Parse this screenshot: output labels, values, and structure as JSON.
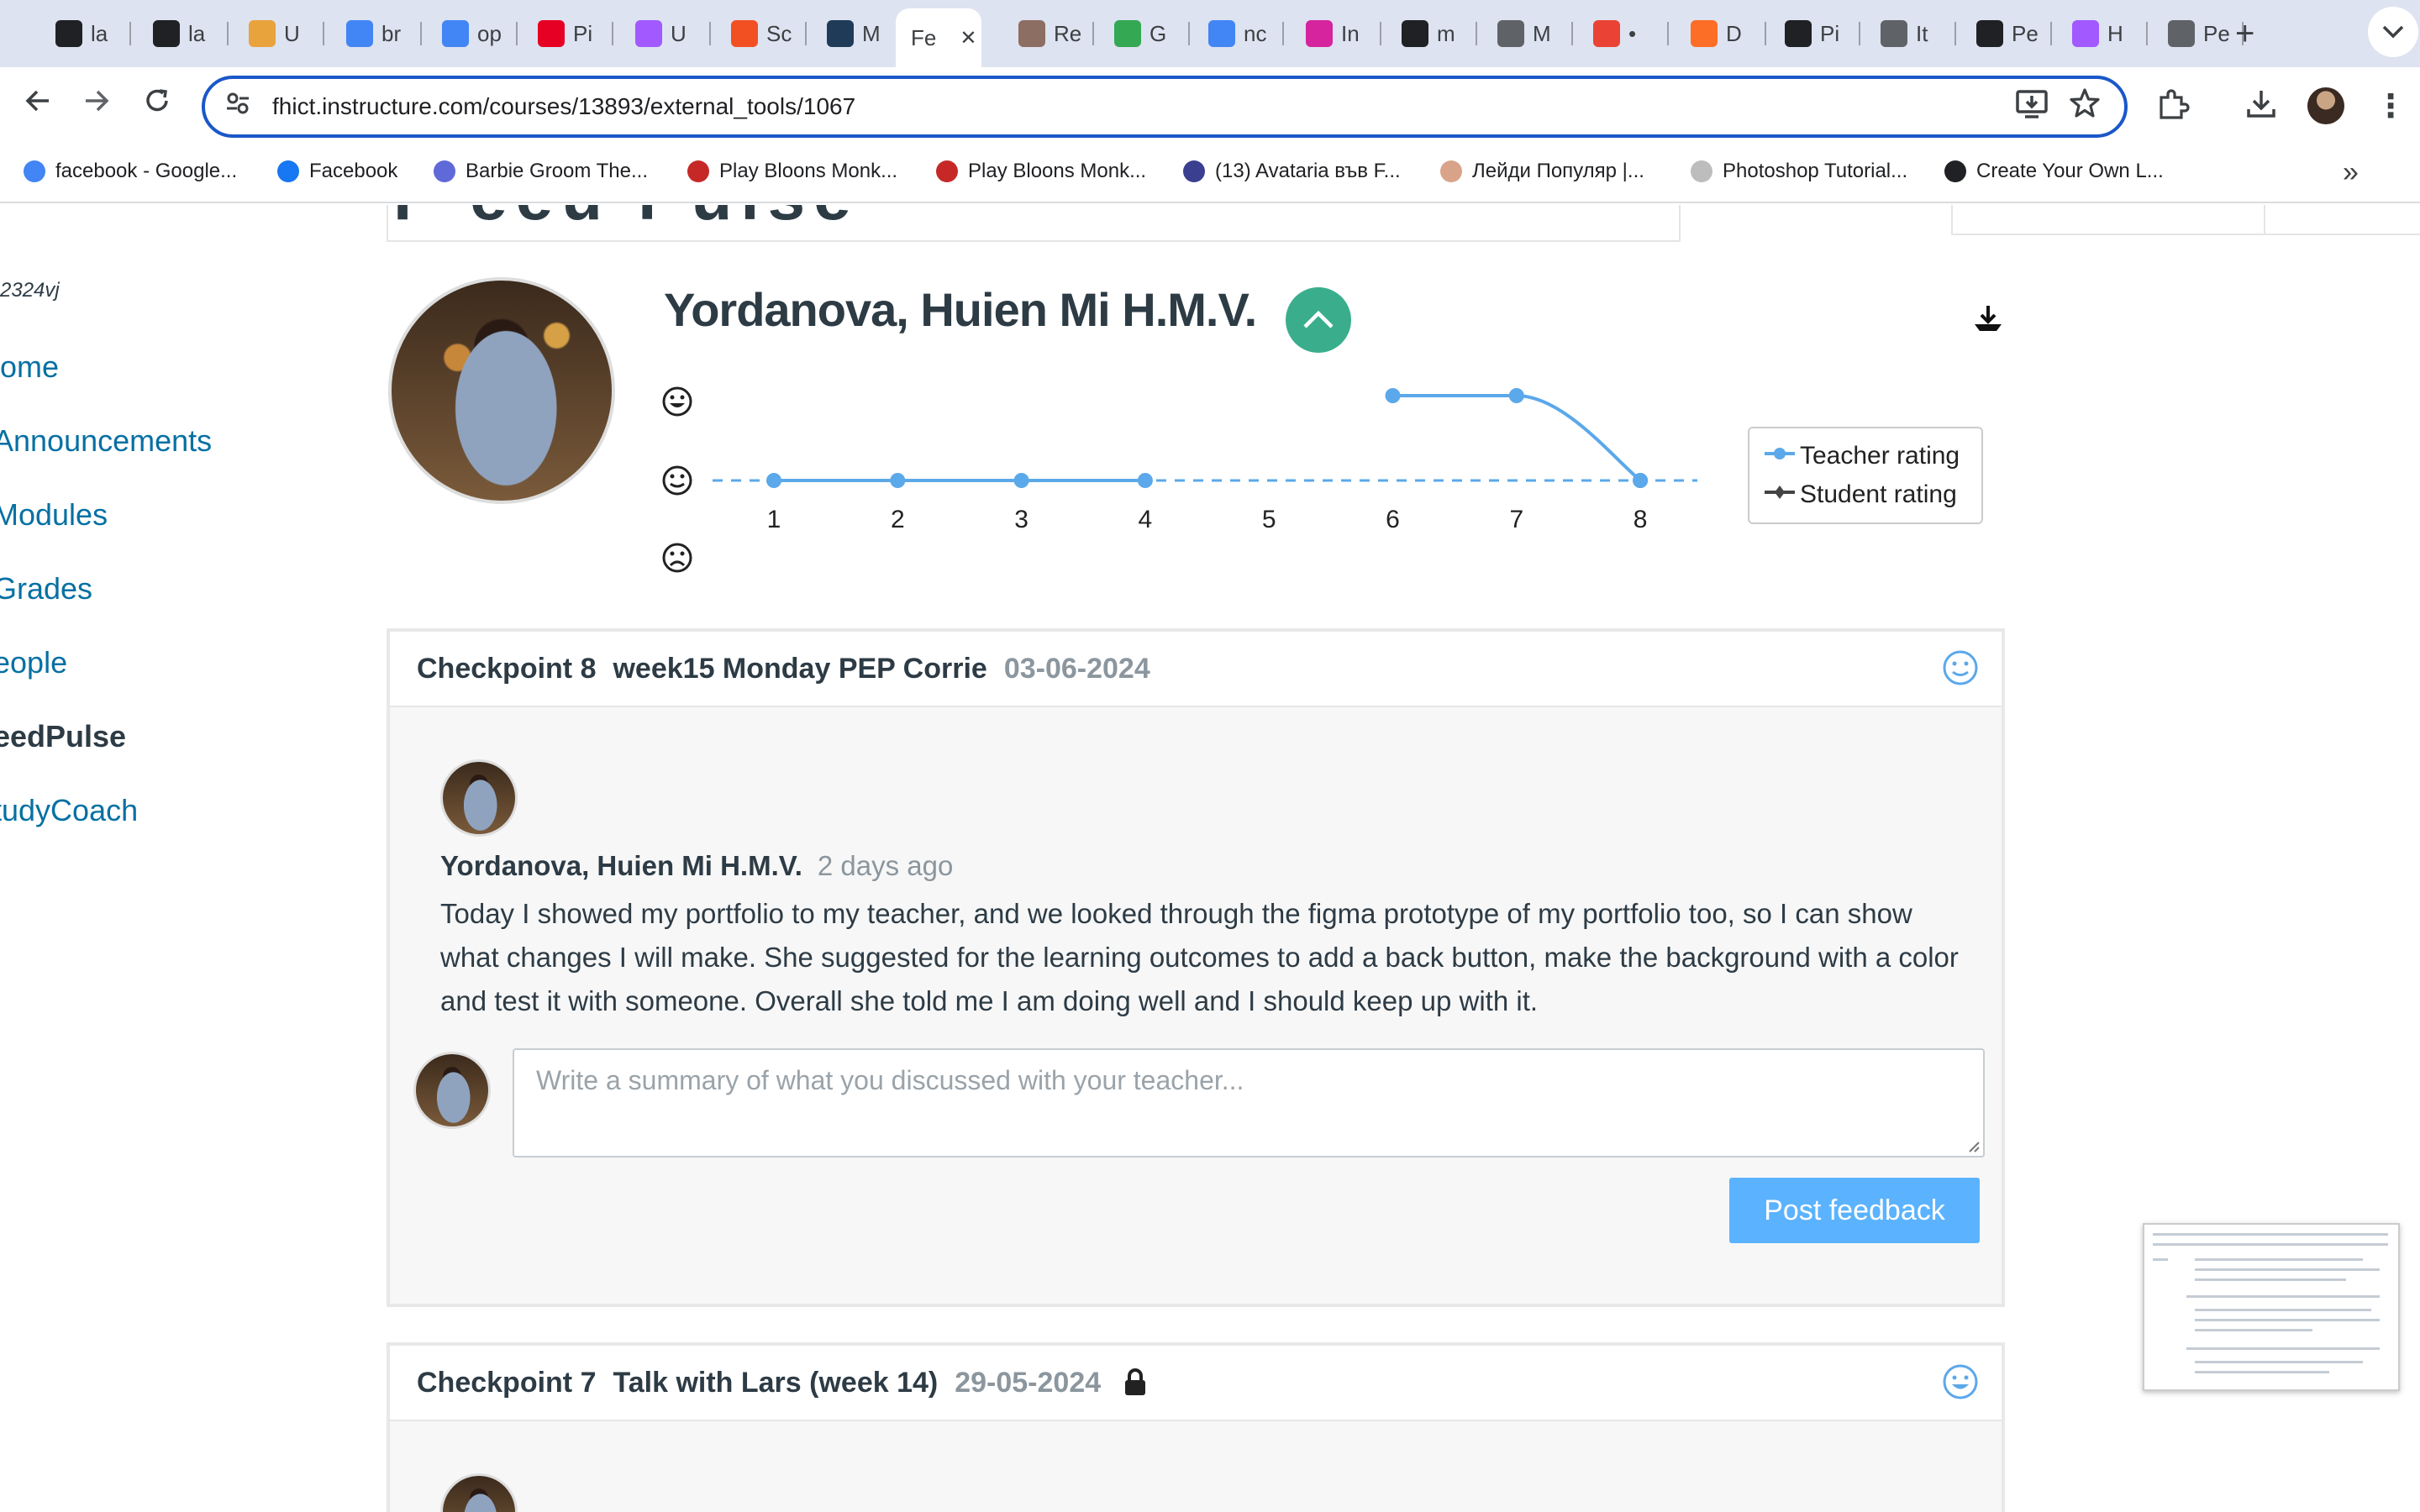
{
  "browser": {
    "tabs": [
      {
        "label": "la",
        "icon": "github-icon",
        "color": "#202124"
      },
      {
        "label": "la",
        "icon": "github-icon",
        "color": "#202124"
      },
      {
        "label": "U",
        "icon": "hat-icon",
        "color": "#e8a33c"
      },
      {
        "label": "br",
        "icon": "google-icon",
        "color": "#4285f4"
      },
      {
        "label": "op",
        "icon": "google-icon",
        "color": "#4285f4"
      },
      {
        "label": "Pi",
        "icon": "pinterest-icon",
        "color": "#e60023"
      },
      {
        "label": "U",
        "icon": "figma-icon",
        "color": "#a259ff"
      },
      {
        "label": "Sc",
        "icon": "grid-icon",
        "color": "#f25022"
      },
      {
        "label": "M",
        "icon": "k-icon",
        "color": "#1f3b57"
      },
      {
        "label": "Fe",
        "icon": "",
        "color": "#ffffff",
        "active": true
      },
      {
        "label": "Re",
        "icon": "puzzle-icon",
        "color": "#8d6e63"
      },
      {
        "label": "G",
        "icon": "maps-icon",
        "color": "#34a853"
      },
      {
        "label": "nc",
        "icon": "google-icon",
        "color": "#4285f4"
      },
      {
        "label": "In",
        "icon": "instagram-icon",
        "color": "#d6249f"
      },
      {
        "label": "m",
        "icon": "github-icon",
        "color": "#202124"
      },
      {
        "label": "M",
        "icon": "globe-icon",
        "color": "#5f6368"
      },
      {
        "label": "•",
        "icon": "chrome-icon",
        "color": "#ea4335"
      },
      {
        "label": "D",
        "icon": "gitlab-icon",
        "color": "#fc6d26"
      },
      {
        "label": "Pi",
        "icon": "dark-logo-icon",
        "color": "#202124"
      },
      {
        "label": "It",
        "icon": "globe-icon",
        "color": "#5f6368"
      },
      {
        "label": "Pe",
        "icon": "medium-icon",
        "color": "#202124"
      },
      {
        "label": "H",
        "icon": "figma-icon",
        "color": "#a259ff"
      },
      {
        "label": "Pe",
        "icon": "globe-icon",
        "color": "#5f6368"
      }
    ],
    "url": "fhict.instructure.com/courses/13893/external_tools/1067",
    "bookmarks": [
      {
        "label": "facebook - Google...",
        "color": "#4285f4"
      },
      {
        "label": "Facebook",
        "color": "#1877f2"
      },
      {
        "label": "Barbie Groom The...",
        "color": "#5f6ad8"
      },
      {
        "label": "Play Bloons Monk...",
        "color": "#c62828"
      },
      {
        "label": "Play Bloons Monk...",
        "color": "#c62828"
      },
      {
        "label": "(13) Avataria във F...",
        "color": "#3a3f8f"
      },
      {
        "label": "Лейди Популяр |...",
        "color": "#d9a38a"
      },
      {
        "label": "Photoshop Tutorial...",
        "color": "#bdbdbd"
      },
      {
        "label": "Create Your Own L...",
        "color": "#202124"
      }
    ]
  },
  "sidebar": {
    "id_text": "2324vj",
    "items": [
      "lome",
      "Announcements",
      "Modules",
      "Grades",
      "eople",
      "eedPulse",
      "tudyCoach"
    ]
  },
  "header": {
    "cutoff_title": "F eeu Pulse",
    "student_name": "Yordanova, Huien Mi H.M.V."
  },
  "chart_data": {
    "type": "line",
    "x": [
      1,
      2,
      3,
      4,
      5,
      6,
      7,
      8
    ],
    "y_levels": [
      "happy",
      "neutral",
      "sad"
    ],
    "series": [
      {
        "name": "Teacher rating",
        "color": "#5ba8ea",
        "values": [
          null,
          null,
          null,
          null,
          null,
          2,
          2,
          1
        ]
      },
      {
        "name": "Student rating",
        "color": "#5ba8ea",
        "values": [
          1,
          1,
          1,
          1,
          null,
          null,
          null,
          1
        ]
      }
    ],
    "legend": "right"
  },
  "cards": [
    {
      "checkpoint": "Checkpoint 8",
      "title": "week15 Monday PEP Corrie",
      "date": "03-06-2024",
      "post": {
        "author": "Yordanova, Huien Mi H.M.V.",
        "time": "2 days ago",
        "text": "Today I showed my portfolio to my teacher, and we looked through the figma prototype of my portfolio too, so I can show what changes I will make. She suggested for the learning outcomes to add a back button, make the background with a color and test it with someone. Overall she told me I am doing well and I should keep up with it."
      },
      "textarea_placeholder": "Write a summary of what you discussed with your teacher...",
      "button": "Post feedback"
    },
    {
      "checkpoint": "Checkpoint 7",
      "title": "Talk with Lars (week 14)",
      "date": "29-05-2024",
      "locked": true
    }
  ]
}
